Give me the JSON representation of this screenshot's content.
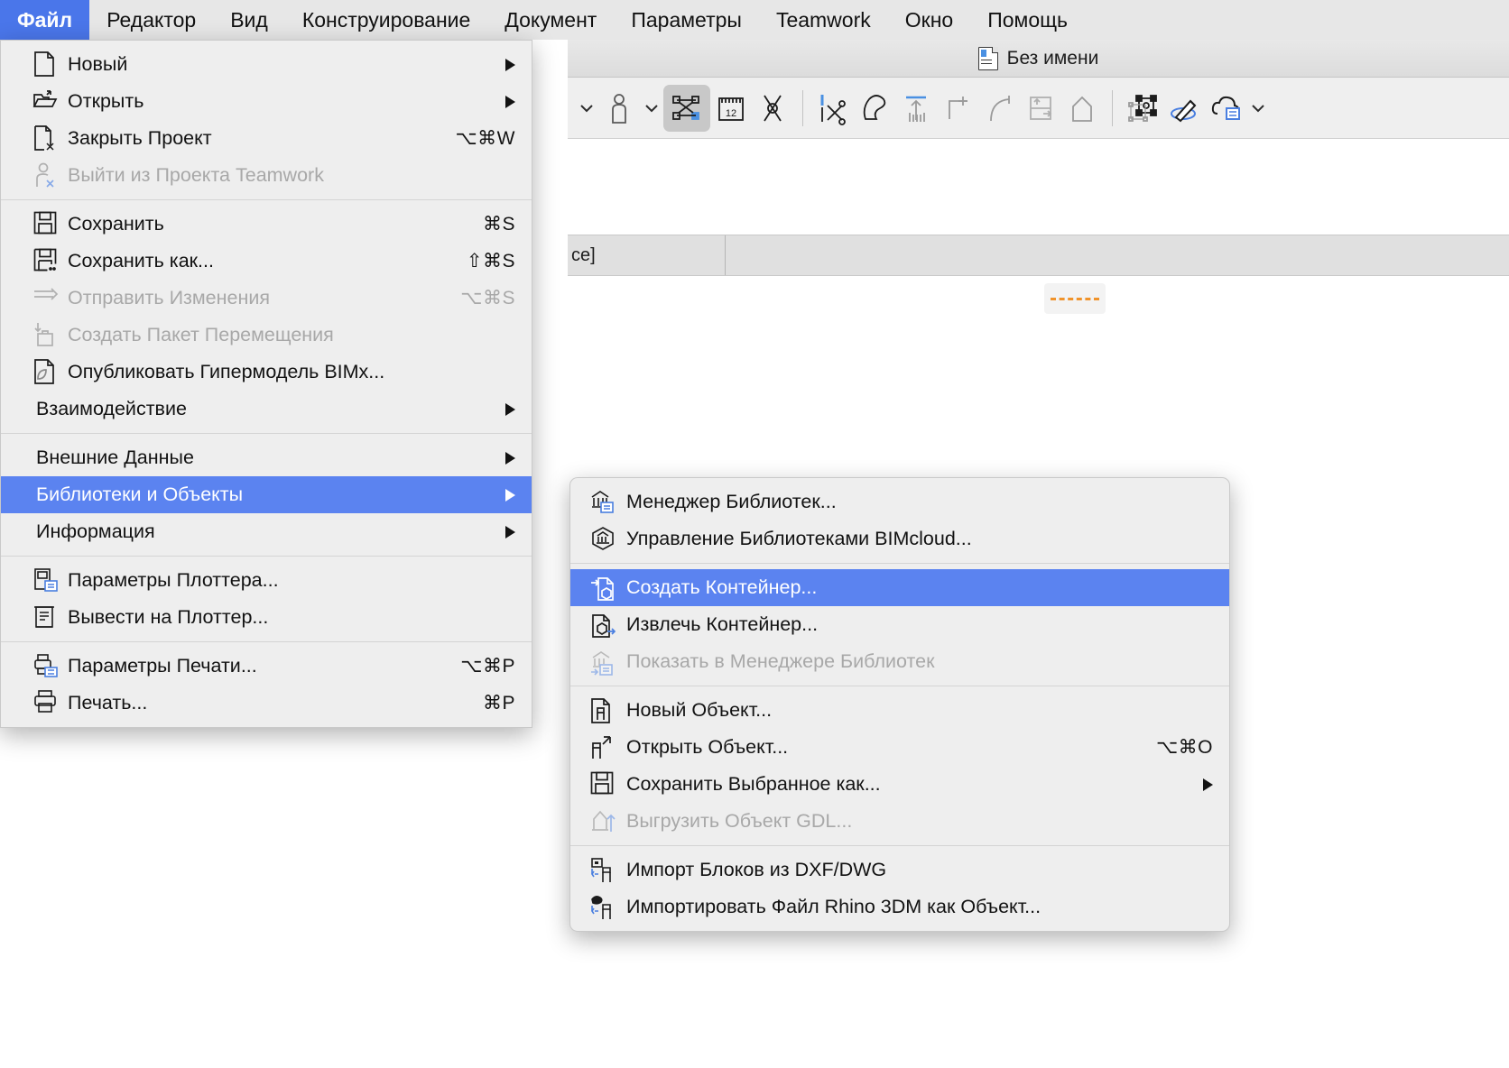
{
  "menubar": {
    "items": [
      {
        "label": "Файл",
        "active": true
      },
      {
        "label": "Редактор",
        "active": false
      },
      {
        "label": "Вид",
        "active": false
      },
      {
        "label": "Конструирование",
        "active": false
      },
      {
        "label": "Документ",
        "active": false
      },
      {
        "label": "Параметры",
        "active": false
      },
      {
        "label": "Teamwork",
        "active": false
      },
      {
        "label": "Окно",
        "active": false
      },
      {
        "label": "Помощь",
        "active": false
      }
    ]
  },
  "window": {
    "title": "Без имени",
    "doc_icon": "document-icon"
  },
  "toolbar": {
    "icons": [
      "chevron-down-icon",
      "person-tool-icon",
      "chevron-down-icon",
      "magic-wand-select-icon",
      "measure-tape-icon",
      "node-tool-icon",
      "split-scissors-icon",
      "trim-icon",
      "multiply-icon",
      "offset-corner-icon",
      "fillet-icon",
      "push-pull-icon",
      "elevate-icon",
      "transform-node-icon",
      "edit-pencil-icon",
      "cloud-list-icon",
      "chevron-down-icon"
    ],
    "active_icon": "magic-wand-select-icon"
  },
  "canvas": {
    "info_cell_text": "ce]",
    "dashed_marker": "dashed-orange-line"
  },
  "file_menu": {
    "groups": [
      [
        {
          "icon": "new-document-icon",
          "label": "Новый",
          "shortcut": "",
          "submenu": true,
          "disabled": false,
          "selected": false
        },
        {
          "icon": "open-folder-icon",
          "label": "Открыть",
          "shortcut": "",
          "submenu": true,
          "disabled": false,
          "selected": false
        },
        {
          "icon": "close-project-icon",
          "label": "Закрыть Проект",
          "shortcut": "⌥⌘W",
          "submenu": false,
          "disabled": false,
          "selected": false
        },
        {
          "icon": "leave-teamwork-icon",
          "label": "Выйти из Проекта Teamwork",
          "shortcut": "",
          "submenu": false,
          "disabled": true,
          "selected": false
        }
      ],
      [
        {
          "icon": "save-icon",
          "label": "Сохранить",
          "shortcut": "⌘S",
          "submenu": false,
          "disabled": false,
          "selected": false
        },
        {
          "icon": "save-as-icon",
          "label": "Сохранить как...",
          "shortcut": "⇧⌘S",
          "submenu": false,
          "disabled": false,
          "selected": false
        },
        {
          "icon": "send-changes-icon",
          "label": "Отправить Изменения",
          "shortcut": "⌥⌘S",
          "submenu": false,
          "disabled": true,
          "selected": false
        },
        {
          "icon": "create-travel-package-icon",
          "label": "Создать Пакет Перемещения",
          "shortcut": "",
          "submenu": false,
          "disabled": true,
          "selected": false
        },
        {
          "icon": "publish-bimx-icon",
          "label": "Опубликовать Гипермодель BIMx...",
          "shortcut": "",
          "submenu": false,
          "disabled": false,
          "selected": false
        },
        {
          "icon": "",
          "label": "Взаимодействие",
          "shortcut": "",
          "submenu": true,
          "disabled": false,
          "selected": false
        }
      ],
      [
        {
          "icon": "",
          "label": "Внешние Данные",
          "shortcut": "",
          "submenu": true,
          "disabled": false,
          "selected": false
        },
        {
          "icon": "",
          "label": "Библиотеки и Объекты",
          "shortcut": "",
          "submenu": true,
          "disabled": false,
          "selected": true
        },
        {
          "icon": "",
          "label": "Информация",
          "shortcut": "",
          "submenu": true,
          "disabled": false,
          "selected": false
        }
      ],
      [
        {
          "icon": "plotter-settings-icon",
          "label": "Параметры Плоттера...",
          "shortcut": "",
          "submenu": false,
          "disabled": false,
          "selected": false
        },
        {
          "icon": "plot-icon",
          "label": "Вывести на Плоттер...",
          "shortcut": "",
          "submenu": false,
          "disabled": false,
          "selected": false
        }
      ],
      [
        {
          "icon": "print-settings-icon",
          "label": "Параметры Печати...",
          "shortcut": "⌥⌘P",
          "submenu": false,
          "disabled": false,
          "selected": false
        },
        {
          "icon": "print-icon",
          "label": "Печать...",
          "shortcut": "⌘P",
          "submenu": false,
          "disabled": false,
          "selected": false
        }
      ]
    ]
  },
  "libraries_submenu": {
    "groups": [
      [
        {
          "icon": "library-manager-icon",
          "label": "Менеджер Библиотек...",
          "shortcut": "",
          "submenu": false,
          "disabled": false,
          "selected": false
        },
        {
          "icon": "bimcloud-library-icon",
          "label": "Управление Библиотеками BIMcloud...",
          "shortcut": "",
          "submenu": false,
          "disabled": false,
          "selected": false
        }
      ],
      [
        {
          "icon": "create-container-icon",
          "label": "Создать Контейнер...",
          "shortcut": "",
          "submenu": false,
          "disabled": false,
          "selected": true
        },
        {
          "icon": "extract-container-icon",
          "label": "Извлечь Контейнер...",
          "shortcut": "",
          "submenu": false,
          "disabled": false,
          "selected": false
        },
        {
          "icon": "show-in-library-manager-icon",
          "label": "Показать в Менеджере Библиотек",
          "shortcut": "",
          "submenu": false,
          "disabled": true,
          "selected": false
        }
      ],
      [
        {
          "icon": "new-object-icon",
          "label": "Новый Объект...",
          "shortcut": "",
          "submenu": false,
          "disabled": false,
          "selected": false
        },
        {
          "icon": "open-object-icon",
          "label": "Открыть Объект...",
          "shortcut": "⌥⌘O",
          "submenu": false,
          "disabled": false,
          "selected": false
        },
        {
          "icon": "save-selection-as-icon",
          "label": "Сохранить Выбранное как...",
          "shortcut": "",
          "submenu": true,
          "disabled": false,
          "selected": false
        },
        {
          "icon": "upload-gdl-object-icon",
          "label": "Выгрузить Объект GDL...",
          "shortcut": "",
          "submenu": false,
          "disabled": true,
          "selected": false
        }
      ],
      [
        {
          "icon": "import-dxf-blocks-icon",
          "label": "Импорт Блоков из DXF/DWG",
          "shortcut": "",
          "submenu": false,
          "disabled": false,
          "selected": false
        },
        {
          "icon": "import-rhino-icon",
          "label": "Импортировать Файл Rhino 3DM как Объект...",
          "shortcut": "",
          "submenu": false,
          "disabled": false,
          "selected": false
        }
      ]
    ]
  },
  "colors": {
    "accent": "#4a76ea",
    "highlight": "#5b83f0",
    "menu_bg": "#eeeeee",
    "menubar_bg": "#e7e7e7",
    "disabled_text": "#a8a8a8",
    "marker_orange": "#f0932b"
  }
}
